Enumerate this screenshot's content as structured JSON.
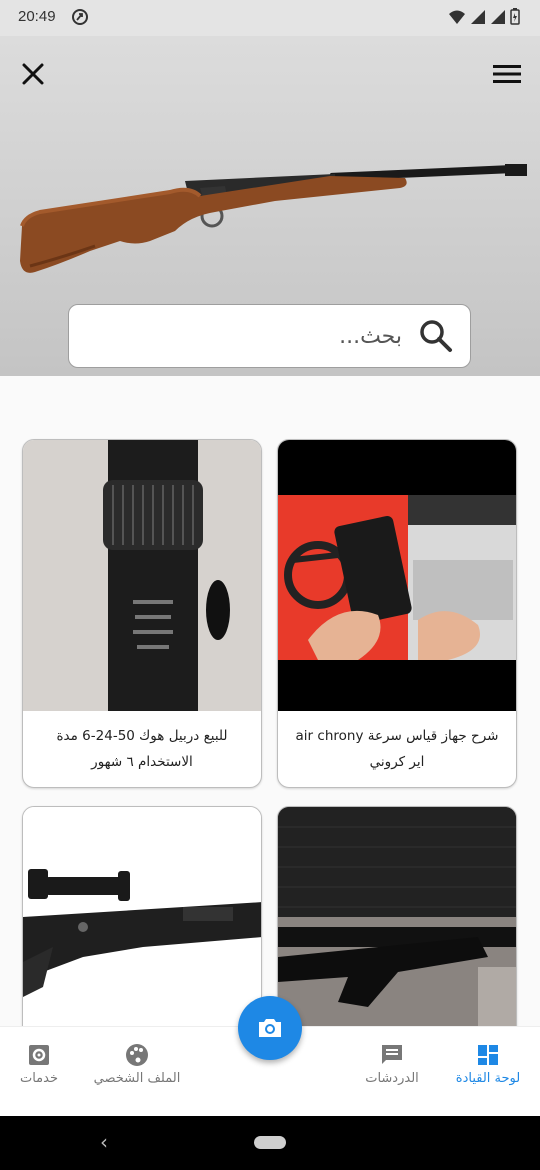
{
  "status_bar": {
    "time": "20:49"
  },
  "header": {
    "search_placeholder": "بحث..."
  },
  "cards": [
    {
      "title": "شرح جهاز قياس سرعة air chrony اير كروني"
    },
    {
      "title": "للبيع دربيل هوك 50-24-6 مدة الاستخدام ٦ شهور"
    },
    {
      "title": ""
    },
    {
      "title": ""
    }
  ],
  "bottom_nav": {
    "dashboard": "لوحة القيادة",
    "chats": "الدردشات",
    "profile": "الملف الشخصي",
    "services": "خدمات"
  },
  "colors": {
    "accent": "#1e88e5",
    "inactive": "#777777"
  },
  "icons": {
    "close": "close-icon",
    "menu": "menu-icon",
    "search": "search-icon",
    "camera": "camera-icon",
    "dashboard": "dashboard-icon",
    "chats": "chat-icon",
    "profile": "palette-icon",
    "services": "gear-icon"
  }
}
